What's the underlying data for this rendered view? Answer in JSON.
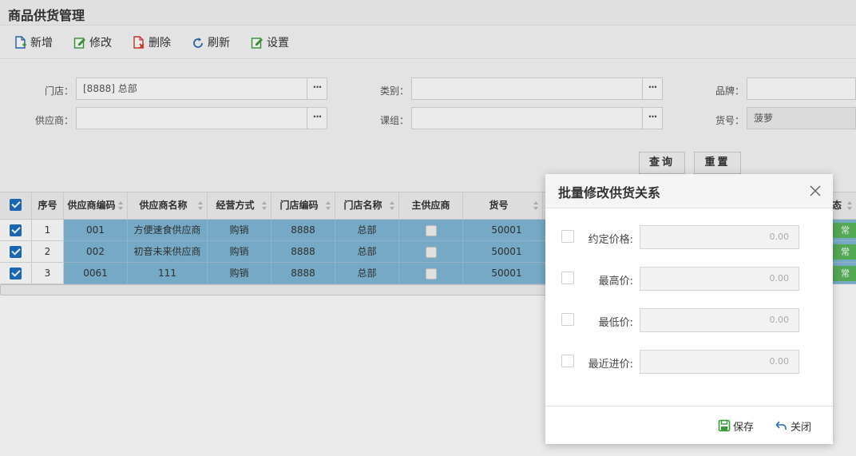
{
  "page": {
    "title": "商品供货管理"
  },
  "toolbar": {
    "items": [
      {
        "label": "新增",
        "icon": "add-doc-icon",
        "color": "#2a66b8"
      },
      {
        "label": "修改",
        "icon": "edit-icon",
        "color": "#3a9a3a"
      },
      {
        "label": "删除",
        "icon": "delete-doc-icon",
        "color": "#d63a2a"
      },
      {
        "label": "刷新",
        "icon": "refresh-icon",
        "color": "#2a66b8"
      },
      {
        "label": "设置",
        "icon": "settings-edit-icon",
        "color": "#3a9a3a"
      }
    ]
  },
  "filters": {
    "store": {
      "label": "门店：",
      "value": "[8888] 总部"
    },
    "supplier": {
      "label": "供应商：",
      "value": ""
    },
    "category": {
      "label": "类别：",
      "value": ""
    },
    "group": {
      "label": "课组：",
      "value": ""
    },
    "brand": {
      "label": "品牌：",
      "value": ""
    },
    "item_no": {
      "label": "货号：",
      "value": "菠萝"
    },
    "picker_glyph": "···",
    "query_label": "查询",
    "reset_label": "重置"
  },
  "grid": {
    "headers": [
      "序号",
      "供应商编码",
      "供应商名称",
      "经营方式",
      "门店编码",
      "门店名称",
      "主供应商",
      "货号",
      "态"
    ],
    "rows": [
      {
        "seq": "1",
        "supplier_code": "001",
        "supplier_name": "方便速食供应商",
        "mode": "购销",
        "store_code": "8888",
        "store_name": "总部",
        "main": false,
        "item_no": "50001",
        "status": "常"
      },
      {
        "seq": "2",
        "supplier_code": "002",
        "supplier_name": "初音未来供应商",
        "mode": "购销",
        "store_code": "8888",
        "store_name": "总部",
        "main": false,
        "item_no": "50001",
        "status": "常"
      },
      {
        "seq": "3",
        "supplier_code": "0061",
        "supplier_name": "111",
        "mode": "购销",
        "store_code": "8888",
        "store_name": "总部",
        "main": false,
        "item_no": "50001",
        "status": "常"
      }
    ]
  },
  "modal": {
    "title": "批量修改供货关系",
    "fields": [
      {
        "label": "约定价格:",
        "placeholder": "0.00"
      },
      {
        "label": "最高价:",
        "placeholder": "0.00"
      },
      {
        "label": "最低价:",
        "placeholder": "0.00"
      },
      {
        "label": "最近进价:",
        "placeholder": "0.00"
      }
    ],
    "save_label": "保存",
    "close_label": "关闭"
  },
  "colors": {
    "selected_row": "#7fb8d6",
    "checkbox_blue": "#1d6fc2",
    "status_green": "#5cb85c",
    "save_green": "#3a9a3a",
    "close_blue": "#2a66b8"
  }
}
